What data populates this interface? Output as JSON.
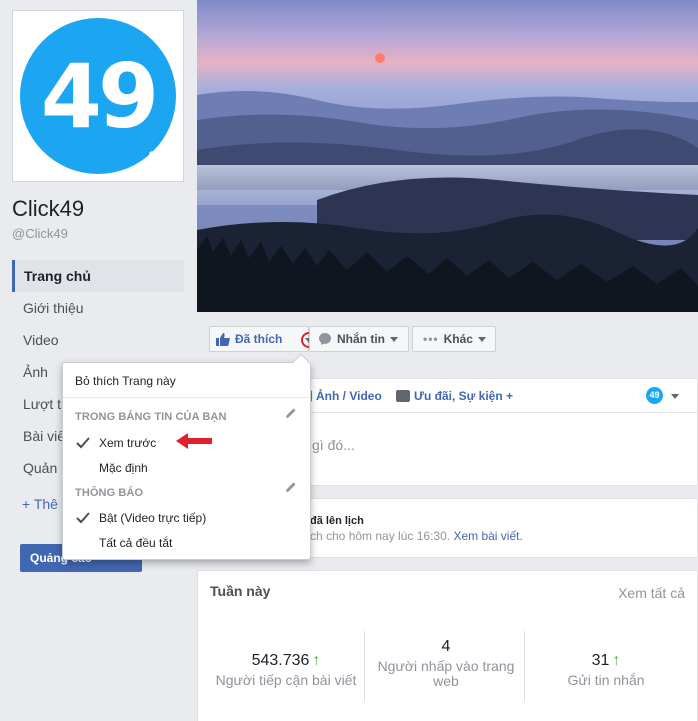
{
  "page": {
    "avatar_text": "49",
    "name": "Click49",
    "handle": "@Click49"
  },
  "nav": {
    "items": [
      {
        "label": "Trang chủ",
        "active": true
      },
      {
        "label": "Giới thiệu"
      },
      {
        "label": "Video"
      },
      {
        "label": "Ảnh"
      },
      {
        "label": "Lượt t"
      },
      {
        "label": "Bài viế"
      },
      {
        "label": "Quản"
      }
    ],
    "add_label": "+ Thê",
    "promote_label": "Quảng cáo"
  },
  "actions": {
    "like_label": "Đã thích",
    "message_label": "Nhắn tin",
    "more_label": "Khác"
  },
  "composer": {
    "tab_photo_video": "Ảnh / Video",
    "tab_offer_event": "Ưu đãi, Sự kiện +",
    "badge": "49",
    "placeholder": "gì đó..."
  },
  "scheduled": {
    "title": "đã lên lịch",
    "subtitle": "ch cho hôm nay lúc 16:30.",
    "link": "Xem bài viết."
  },
  "week": {
    "title": "Tuần này",
    "see_all": "Xem tất cả",
    "stats": [
      {
        "value": "543.736",
        "label": "Người tiếp cận bài viết",
        "trend": "↑"
      },
      {
        "value": "4",
        "label": "Người nhấp vào trang web",
        "trend": ""
      },
      {
        "value": "31",
        "label": "Gửi tin nhắn",
        "trend": "↑"
      }
    ]
  },
  "dropdown": {
    "unlike": "Bỏ thích Trang này",
    "newsfeed_section": "TRONG BẢNG TIN CỦA BẠN",
    "see_first": "Xem trước",
    "default": "Mặc định",
    "notifications_section": "THÔNG BÁO",
    "on_live": "Bật (Video trực tiếp)",
    "all_off": "Tất cả đều tắt"
  },
  "colors": {
    "brand_blue": "#4267b2",
    "avatar_blue": "#1ca5f0",
    "highlight_red": "#e0202b",
    "trend_green": "#42b72a"
  }
}
